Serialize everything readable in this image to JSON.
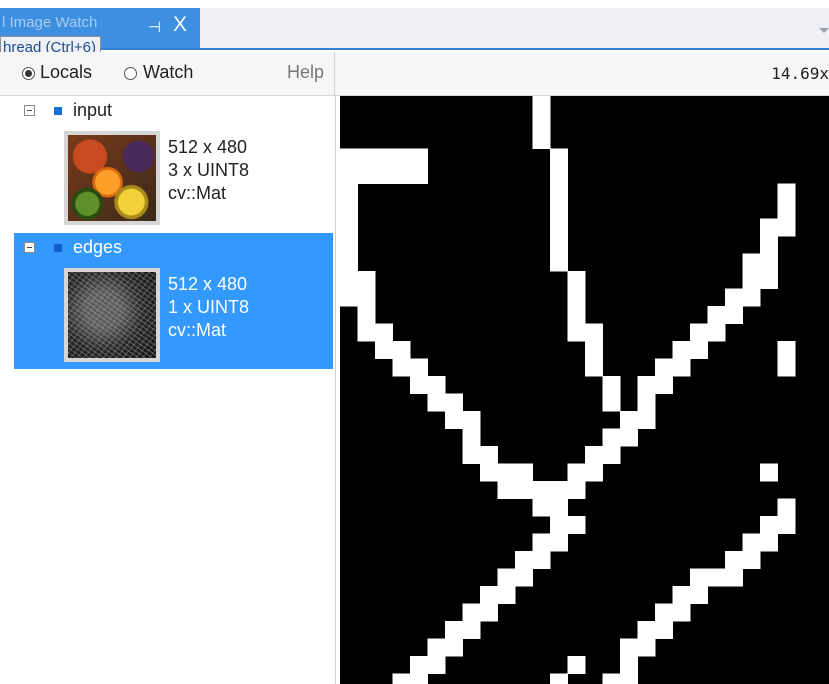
{
  "tab": {
    "title": "Image Watch",
    "prefix": "l ",
    "pin_glyph": "⊣",
    "close_glyph": "X"
  },
  "tooltip": {
    "text": "hread (Ctrl+6)"
  },
  "toolbar": {
    "locals_label": "Locals",
    "watch_label": "Watch",
    "help_label": "Help",
    "selected_mode": "Locals",
    "zoom": "14.69x"
  },
  "items": [
    {
      "name": "input",
      "size": "512 x 480",
      "type": "3 x UINT8",
      "class": "cv::Mat",
      "selected": false
    },
    {
      "name": "edges",
      "size": "512 x 480",
      "type": "1 x UINT8",
      "class": "cv::Mat",
      "selected": true
    }
  ],
  "colors": {
    "accent": "#3399ff",
    "tab": "#3d8fe0",
    "viewer_bg": "#000000",
    "pixel_on": "#ffffff"
  },
  "viewer": {
    "description_none": "",
    "pixel_grid": [
      "00000000000100000000000000",
      "00000000000100000000000000",
      "00000000000100000000000000",
      "11111000000010000000000000",
      "11111000000010000000000000",
      "10000000000010000000000001",
      "10000000000010000000000001",
      "10000000000010000000000011",
      "10000000000010000000000010",
      "10000000000010000000000110",
      "11000000000001000000000110",
      "11000000000001000000001100",
      "01000000000001000000011000",
      "01100000000001100000110000",
      "00110000000000100001100001",
      "00011000000000100011000001",
      "00001100000000010110000000",
      "00000110000000010100000000",
      "00000011000000001100000000",
      "00000001000000011000000000",
      "00000001100000110000000000",
      "00000000111001100000000010",
      "00000000011111000000000000",
      "00000000000110000000000001",
      "00000000000011000000000011",
      "00000000000110000000000110",
      "00000000001100000000001100",
      "00000000011000000000111000",
      "00000000110000000001100000",
      "00000001100000000011000000",
      "00000011000000000110000000",
      "00000110000000001100000000",
      "00001100000001001000000000",
      "00011000000010011000000000"
    ]
  }
}
